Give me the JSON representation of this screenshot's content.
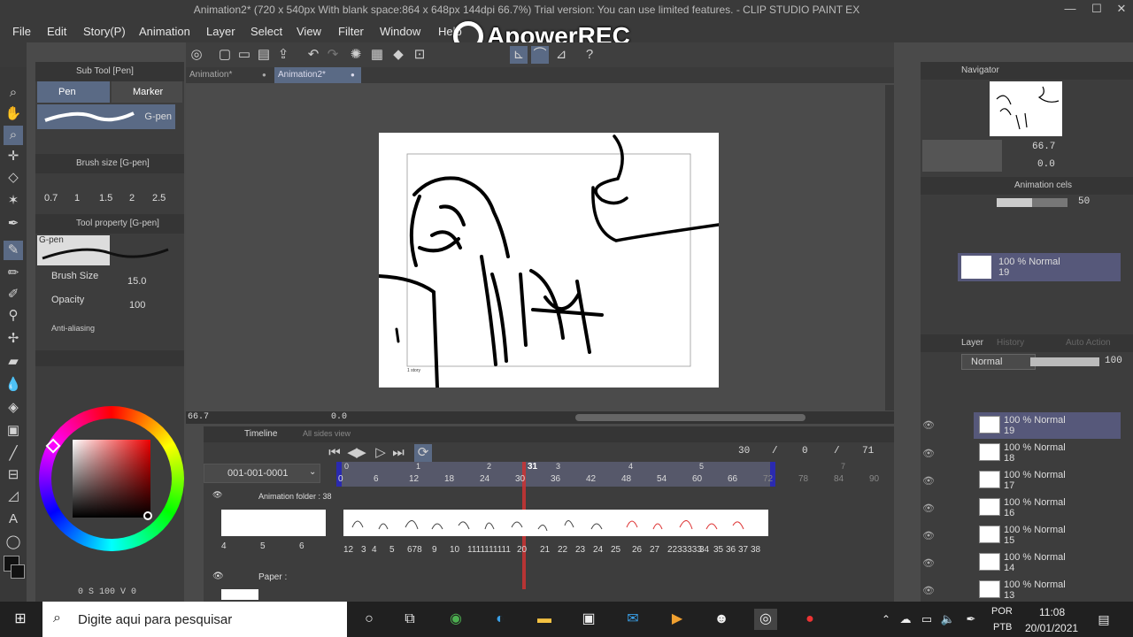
{
  "window": {
    "title": "Animation2* (720 x 540px With blank space:864 x 648px 144dpi 66.7%)  Trial version: You can use limited features. - CLIP STUDIO PAINT EX",
    "minimize": "—",
    "maximize": "☐",
    "close": "✕"
  },
  "menu": [
    "File",
    "Edit",
    "Story(P)",
    "Animation",
    "Layer",
    "Select",
    "View",
    "Filter",
    "Window",
    "Help"
  ],
  "watermark": "ApowerREC",
  "doc_tabs": [
    {
      "label": "Animation*",
      "close": "●"
    },
    {
      "label": "Animation2*",
      "close": "●"
    }
  ],
  "subtool": {
    "header": "Sub Tool [Pen]",
    "tabs": [
      "Pen",
      "Marker"
    ],
    "brush_name": "G-pen"
  },
  "brush_size_panel": {
    "header": "Brush size [G-pen]",
    "sizes": [
      "0.7",
      "1",
      "1.5",
      "2",
      "2.5"
    ]
  },
  "tool_property": {
    "header": "Tool property [G-pen]",
    "brush_name": "G-pen",
    "brush_size_label": "Brush Size",
    "brush_size_value": "15.0",
    "opacity_label": "Opacity",
    "opacity_value": "100",
    "anti_aliasing_label": "Anti-aliasing"
  },
  "color": {
    "main": "#111111",
    "sub": "#111111",
    "footer": "0 S 100 V 0"
  },
  "canvas_status": {
    "zoom": "66.7",
    "rotation": "0.0"
  },
  "canvas_text": "1 story",
  "timeline": {
    "header": "Timeline",
    "all_sides_view": "All sides view",
    "track_name": "001-001-0001",
    "frame_current": "30",
    "frame_slash": "/",
    "frame_zero": "0",
    "frame_slash2": "/",
    "frame_total": "71",
    "sec_marks": [
      "0",
      "1",
      "2",
      "3",
      "4",
      "5",
      "7"
    ],
    "frame_marks": [
      "0",
      "6",
      "12",
      "18",
      "24",
      "30",
      "36",
      "42",
      "48",
      "54",
      "60",
      "66",
      "72",
      "78",
      "84",
      "90"
    ],
    "playhead": "31",
    "folder_label": "Animation folder : 38",
    "left_cel_numbers": [
      "4",
      "5",
      "6"
    ],
    "cel_numbers": [
      "12",
      "3",
      "4",
      "5",
      "678",
      "9",
      "10",
      "1111111111",
      "20",
      "21",
      "22",
      "23",
      "24",
      "25",
      "26",
      "27",
      "2233333",
      "34",
      "35",
      "36",
      "37",
      "38"
    ],
    "paper_label": "Paper :"
  },
  "navigator": {
    "header": "Navigator",
    "zoom": "66.7",
    "rotation": "0.0"
  },
  "animation_cels": {
    "header": "Animation cels",
    "opacity": "50",
    "layer_line1": "100 % Normal",
    "layer_line2": "19"
  },
  "layer_panel": {
    "tabs": [
      "Layer",
      "History",
      "Auto Action"
    ],
    "blend_mode": "Normal",
    "opacity": "100",
    "rows": [
      {
        "l1": "100 % Normal",
        "l2": "19"
      },
      {
        "l1": "100 % Normal",
        "l2": "18"
      },
      {
        "l1": "100 % Normal",
        "l2": "17"
      },
      {
        "l1": "100 % Normal",
        "l2": "16"
      },
      {
        "l1": "100 % Normal",
        "l2": "15"
      },
      {
        "l1": "100 % Normal",
        "l2": "14"
      },
      {
        "l1": "100 % Normal",
        "l2": "13"
      }
    ]
  },
  "taskbar": {
    "search_placeholder": "Digite aqui para pesquisar",
    "lang1": "POR",
    "lang2": "PTB",
    "time": "11:08",
    "date": "20/01/2021"
  }
}
